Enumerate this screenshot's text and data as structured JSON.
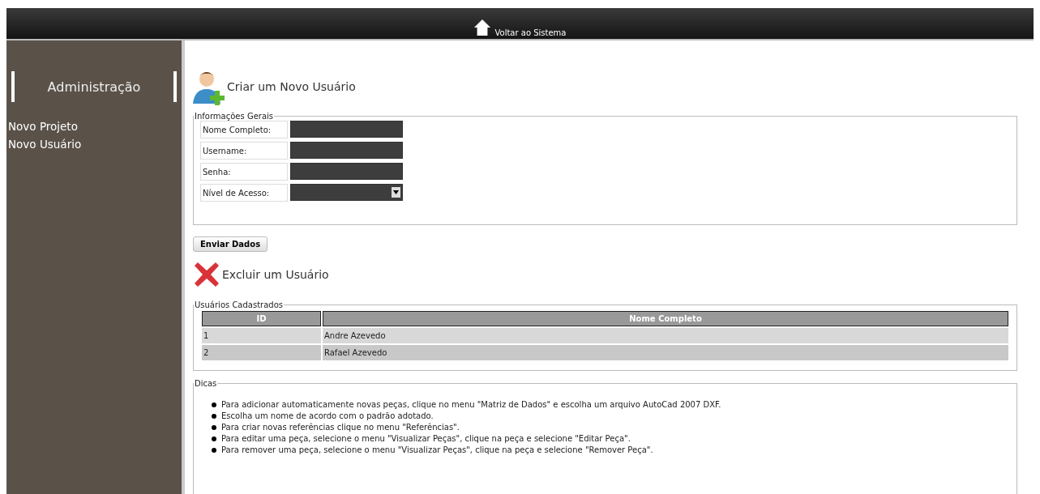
{
  "top_bar": {
    "link": "Voltar ao Sistema"
  },
  "sidebar": {
    "title": "Administração",
    "items": [
      "Novo Projeto",
      "Novo Usuário"
    ]
  },
  "create_section": {
    "title": "Criar um Novo Usuário",
    "fieldset": "Informações Gerais",
    "fields": [
      {
        "label": "Nome Completo:",
        "kind": "text"
      },
      {
        "label": "Username:",
        "kind": "text"
      },
      {
        "label": "Senha:",
        "kind": "password"
      },
      {
        "label": "Nível de Acesso:",
        "kind": "select"
      }
    ],
    "button": "Enviar Dados"
  },
  "delete_section": {
    "title": "Excluir um Usuário",
    "fieldset": "Usuários Cadastrados",
    "table": {
      "columns": [
        "ID",
        "Nome Completo"
      ],
      "rows": [
        [
          "1",
          "Andre Azevedo"
        ],
        [
          "2",
          "Rafael Azevedo"
        ]
      ]
    }
  },
  "tips": {
    "fieldset": "Dicas",
    "items": [
      "Para adicionar automaticamente novas peças, clique no menu \"Matriz de Dados\" e escolha um arquivo AutoCad 2007 DXF.",
      "Escolha um nome de acordo com o padrão adotado.",
      "Para criar novas referências clique no menu \"Referências\".",
      "Para editar uma peça, selecione o menu \"Visualizar Peças\", clique na peça e selecione \"Editar Peça\".",
      "Para remover uma peça, selecione o menu \"Visualizar Peças\", clique na peça e selecione \"Remover Peça\"."
    ]
  }
}
